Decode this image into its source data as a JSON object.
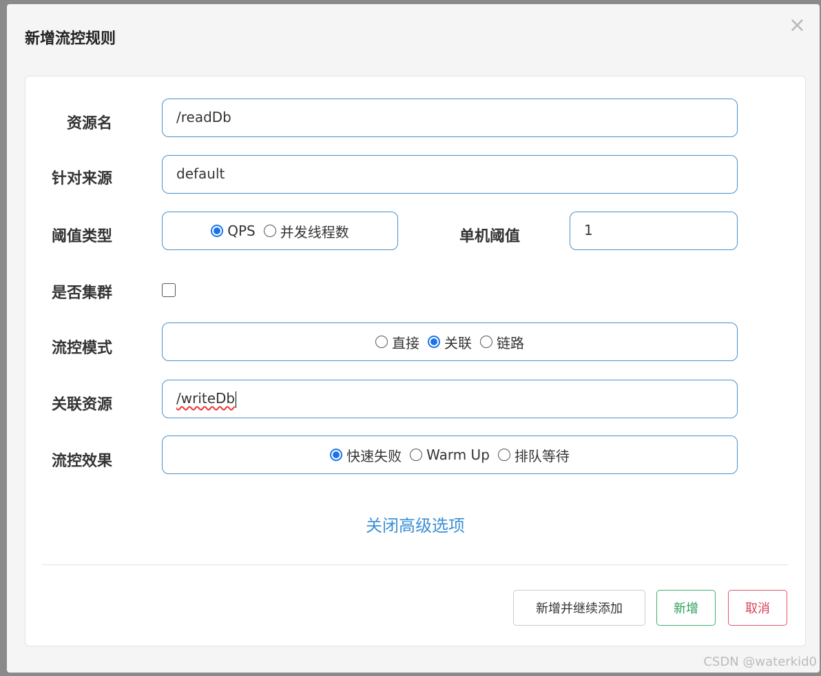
{
  "dialog": {
    "title": "新增流控规则",
    "close_symbol": "×"
  },
  "form": {
    "resource_name": {
      "label": "资源名",
      "value": "/readDb"
    },
    "limit_app": {
      "label": "针对来源",
      "value": "default"
    },
    "grade": {
      "label": "阈值类型",
      "options": [
        "QPS",
        "并发线程数"
      ],
      "selected": "QPS"
    },
    "threshold": {
      "label": "单机阈值",
      "value": "1"
    },
    "cluster": {
      "label": "是否集群",
      "checked": false
    },
    "strategy": {
      "label": "流控模式",
      "options": [
        "直接",
        "关联",
        "链路"
      ],
      "selected": "关联"
    },
    "ref_resource": {
      "label": "关联资源",
      "value": "/writeDb"
    },
    "control_behavior": {
      "label": "流控效果",
      "options": [
        "快速失败",
        "Warm Up",
        "排队等待"
      ],
      "selected": "快速失败"
    },
    "advanced_toggle": "关闭高级选项"
  },
  "buttons": {
    "add_continue": "新增并继续添加",
    "add": "新增",
    "cancel": "取消"
  },
  "watermark": "CSDN @waterkid0",
  "colors": {
    "accent": "#1a73e8",
    "link": "#3b8fd4",
    "success": "#2e9e5b",
    "danger": "#d9405a",
    "field_border": "#4a90c8"
  }
}
